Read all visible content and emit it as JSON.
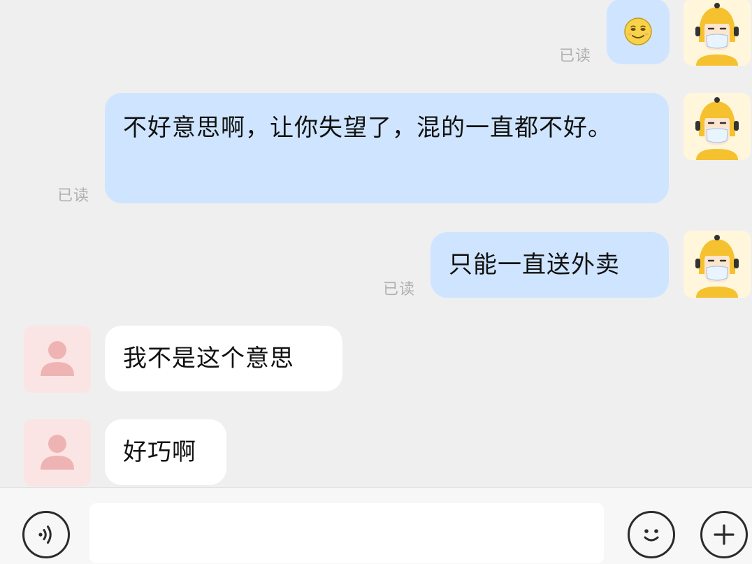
{
  "conversation": {
    "messages": [
      {
        "sender": "self",
        "type": "emoji",
        "emoji_icon": "smiling-face-emoji-icon",
        "read_status": "已读"
      },
      {
        "sender": "self",
        "type": "text",
        "text": "不好意思啊，让你失望了，混的一直都不好。",
        "read_status": "已读"
      },
      {
        "sender": "self",
        "type": "text",
        "text": "只能一直送外卖",
        "read_status": "已读"
      },
      {
        "sender": "other",
        "type": "text",
        "text": "我不是这个意思"
      },
      {
        "sender": "other",
        "type": "text",
        "text": "好巧啊"
      }
    ]
  },
  "input_bar": {
    "voice_icon": "voice-icon",
    "input_value": "",
    "emoji_icon": "emoji-icon",
    "plus_icon": "plus-icon"
  },
  "colors": {
    "background": "#efefef",
    "self_bubble": "#cfe5ff",
    "other_bubble": "#ffffff",
    "read_status": "#b0b0b0",
    "self_avatar_bg": "#fff6dc",
    "self_avatar_helmet": "#f5c12e",
    "other_avatar_bg": "#fbe5e4",
    "other_avatar_figure": "#eeb4b3"
  }
}
